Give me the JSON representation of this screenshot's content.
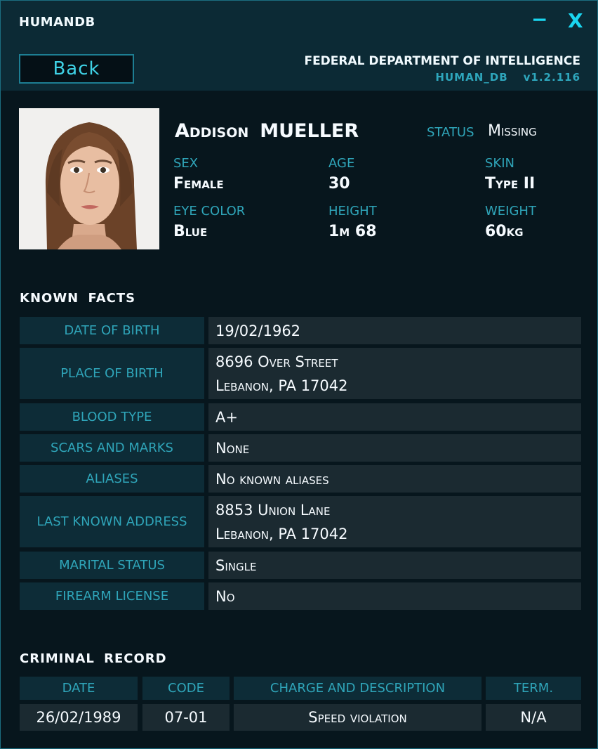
{
  "window": {
    "title": "HUMANDB",
    "minimize_glyph": "−",
    "close_glyph": "X"
  },
  "header": {
    "back_label": "Back",
    "agency": "FEDERAL DEPARTMENT OF INTELLIGENCE",
    "db_name": "HUMAN_DB",
    "version": "v1.2.116"
  },
  "profile": {
    "first_name": "Addison",
    "last_name": "MUELLER",
    "status_label": "STATUS",
    "status": "Missing",
    "attributes": [
      {
        "label": "SEX",
        "value": "Female"
      },
      {
        "label": "AGE",
        "value": "30"
      },
      {
        "label": "SKIN",
        "value": "Type II"
      },
      {
        "label": "EYE COLOR",
        "value": "Blue"
      },
      {
        "label": "HEIGHT",
        "value": "1m 68"
      },
      {
        "label": "WEIGHT",
        "value": "60kg"
      }
    ]
  },
  "known_facts": {
    "title": "KNOWN FACTS",
    "rows": [
      {
        "label": "DATE OF BIRTH",
        "lines": [
          "19/02/1962"
        ]
      },
      {
        "label": "PLACE OF BIRTH",
        "lines": [
          "8696 Over Street",
          "Lebanon, PA 17042"
        ]
      },
      {
        "label": "BLOOD TYPE",
        "lines": [
          "A+"
        ]
      },
      {
        "label": "SCARS AND MARKS",
        "lines": [
          "None"
        ]
      },
      {
        "label": "ALIASES",
        "lines": [
          "No known aliases"
        ]
      },
      {
        "label": "LAST KNOWN ADDRESS",
        "lines": [
          "8853 Union Lane",
          "Lebanon, PA 17042"
        ]
      },
      {
        "label": "MARITAL STATUS",
        "lines": [
          "Single"
        ]
      },
      {
        "label": "FIREARM LICENSE",
        "lines": [
          "No"
        ]
      }
    ]
  },
  "criminal_record": {
    "title": "CRIMINAL RECORD",
    "columns": [
      "DATE",
      "CODE",
      "CHARGE AND DESCRIPTION",
      "TERM."
    ],
    "rows": [
      [
        "26/02/1989",
        "07-01",
        "Speed violation",
        "N/A"
      ]
    ]
  },
  "colors": {
    "accent": "#1ad6f0",
    "label": "#2fa5b9",
    "panel": "#0c2a35",
    "background": "#07161d"
  }
}
